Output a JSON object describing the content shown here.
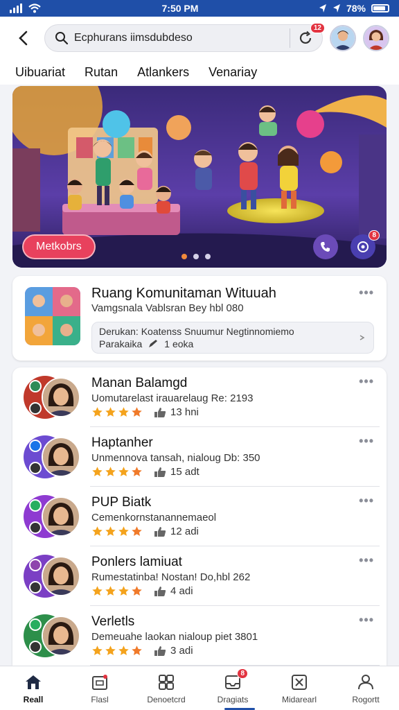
{
  "status": {
    "time": "7:50 PM",
    "battery": "78%"
  },
  "search": {
    "placeholder": "Ecphurans iimsdubdeso",
    "badge": "12"
  },
  "tabs": [
    "Uibuariat",
    "Rutan",
    "Atlankers",
    "Venariay"
  ],
  "banner": {
    "button_label": "Metkobrs",
    "badge": "8",
    "slides": 3,
    "active_slide": 0
  },
  "community": {
    "title": "Ruang Komunitaman Wituuah",
    "subtitle": "Vamgsnala Vablsran Bey hbl 080",
    "box_line1": "Derukan: Koatenss Snuumur Negtinnomiemo",
    "box_line2_label": "Parakaika",
    "box_line2_count": "1 eoka"
  },
  "list": [
    {
      "name": "Manan Balamgd",
      "desc": "Uomutarelast irauarelaug Re: 2193",
      "rating": 4,
      "count": "13 hni",
      "ring": "#c0392b",
      "mini": "#2e8b57"
    },
    {
      "name": "Haptanher",
      "desc": "Unmennova tansah, nialoug Db: 350",
      "rating": 4,
      "count": "15 adt",
      "ring": "#6c4bd1",
      "mini": "#1a73e8"
    },
    {
      "name": "PUP Biatk",
      "desc": "Cemenkornstanannemaeol",
      "rating": 4,
      "count": "12 adi",
      "ring": "#8e3bd1",
      "mini": "#27ae60"
    },
    {
      "name": "Ponlers lamiuat",
      "desc": "Rumestatinba! Nostan! Do,hbl 262",
      "rating": 4,
      "count": "4 adi",
      "ring": "#7b3fc4",
      "mini": "#8e44ad"
    },
    {
      "name": "Verletls",
      "desc": "Demeuahe laokan nialoup piet 3801",
      "rating": 4,
      "count": "3 adi",
      "ring": "#2d8f4a",
      "mini": "#27ae60"
    }
  ],
  "nav": [
    {
      "label": "Reall",
      "icon": "home-icon",
      "active": true
    },
    {
      "label": "Flasl",
      "icon": "store-icon"
    },
    {
      "label": "Denoetcrd",
      "icon": "grid-icon"
    },
    {
      "label": "Dragiats",
      "icon": "inbox-icon",
      "badge": "8"
    },
    {
      "label": "Midarearl",
      "icon": "close-box-icon"
    },
    {
      "label": "Rogortt",
      "icon": "people-icon"
    }
  ],
  "colors": {
    "brand": "#1f4fa8",
    "accent": "#e8415d",
    "star": "#f4a31d"
  }
}
